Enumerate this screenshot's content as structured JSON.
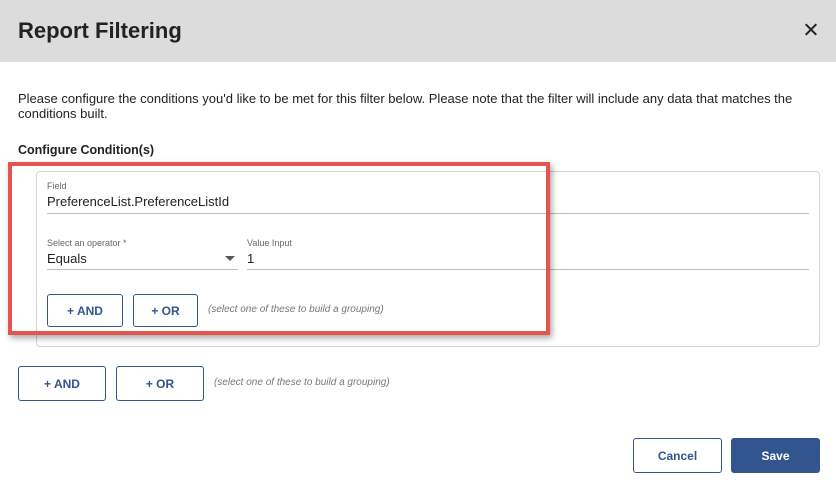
{
  "dialog": {
    "title": "Report Filtering",
    "close_icon": "close-icon"
  },
  "intro_text": "Please configure the conditions you'd like to be met for this filter below. Please note that the filter will include any data that matches the conditions built.",
  "section_label": "Configure Condition(s)",
  "condition": {
    "field_label": "Field",
    "field_value": "PreferenceList.PreferenceListId",
    "operator_label": "Select an operator *",
    "operator_value": "Equals",
    "value_label": "Value Input",
    "value_value": "1",
    "and_label": "+ AND",
    "or_label": "+ OR",
    "hint": "(select one of these to build a grouping)"
  },
  "outer_group": {
    "and_label": "+ AND",
    "or_label": "+ OR",
    "hint": "(select one of these to build a grouping)"
  },
  "footer": {
    "cancel_label": "Cancel",
    "save_label": "Save"
  },
  "colors": {
    "header_bg": "#dcdcdc",
    "accent": "#32548f",
    "highlight": "#e5544f"
  }
}
